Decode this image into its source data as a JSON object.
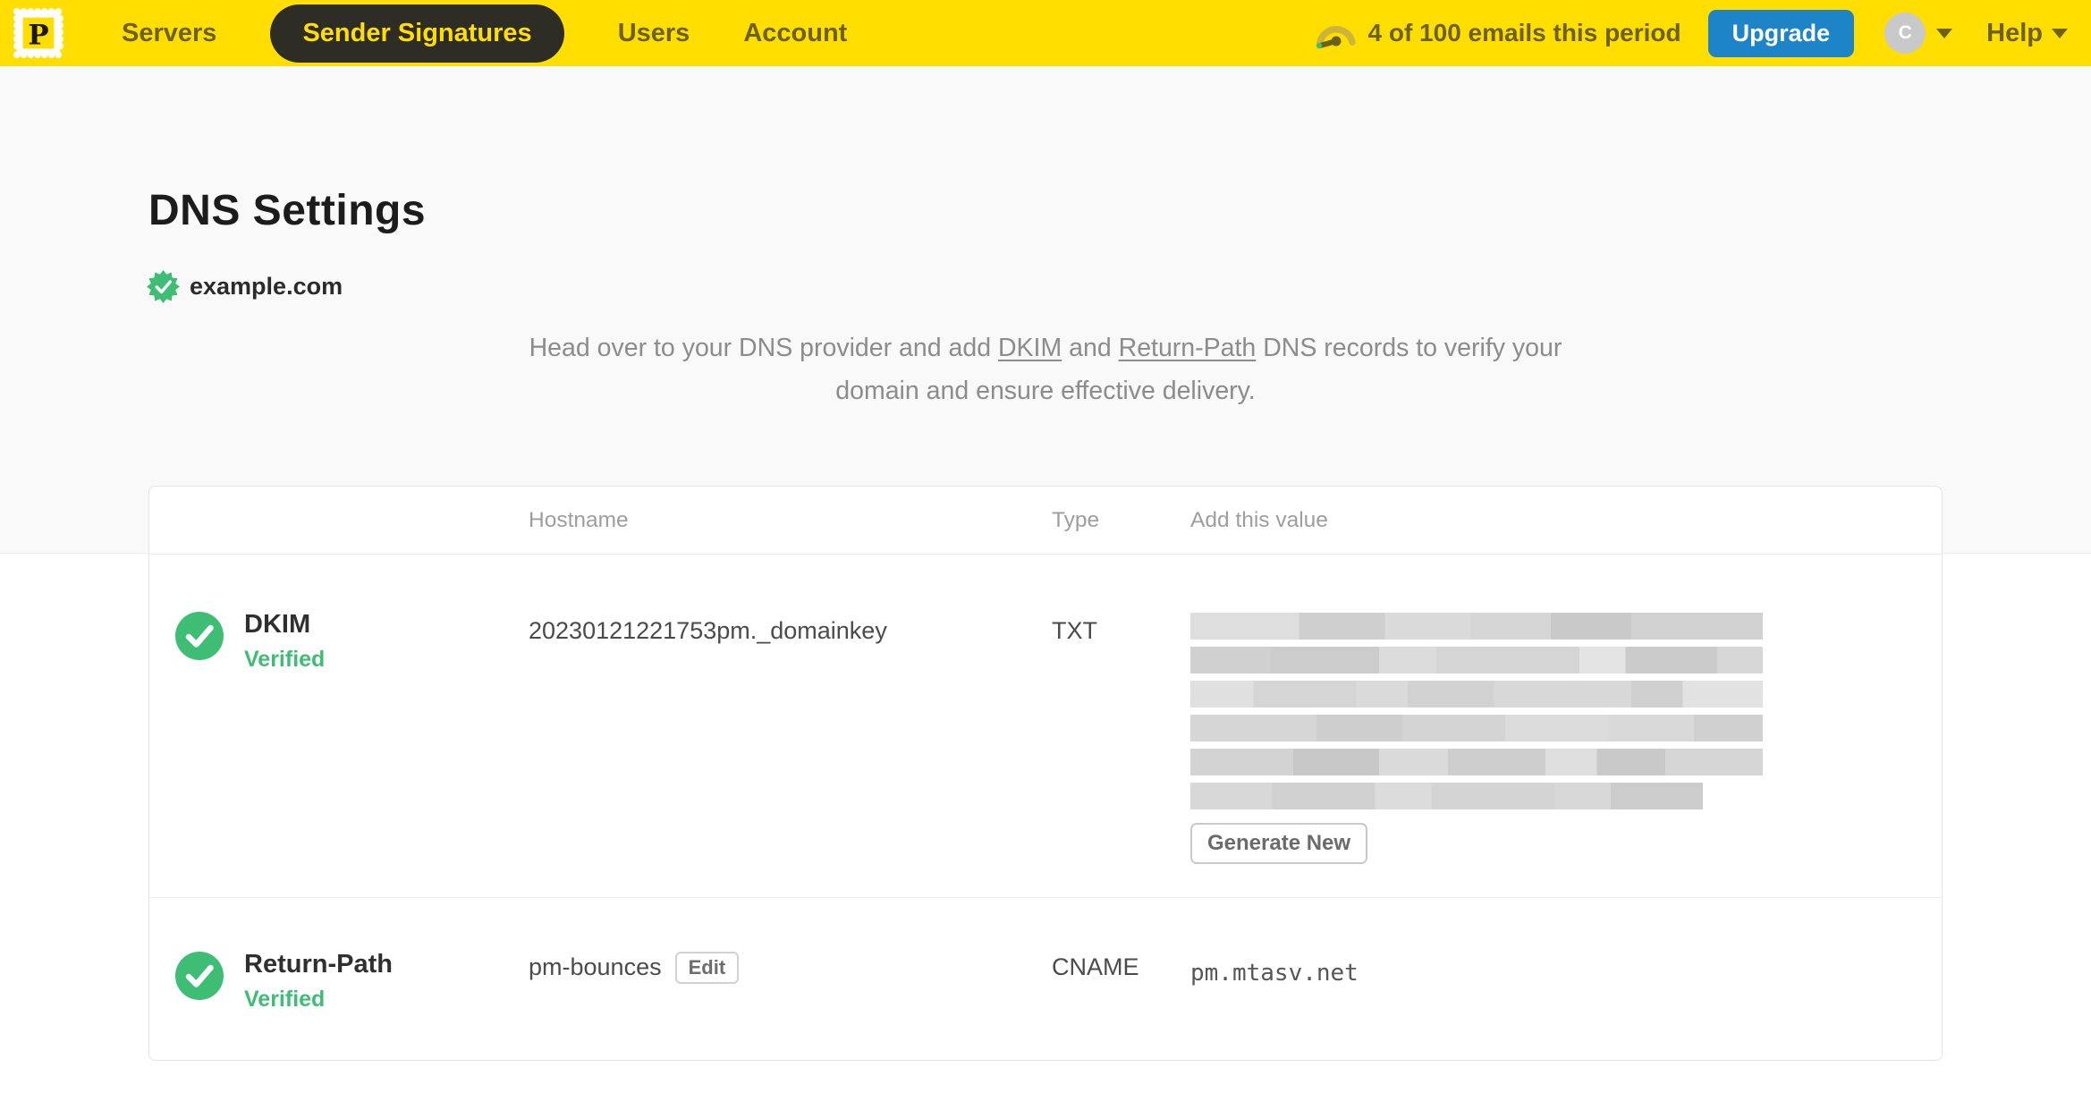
{
  "nav": {
    "logo_letter": "P",
    "items": [
      {
        "label": "Servers",
        "active": false
      },
      {
        "label": "Sender Signatures",
        "active": true
      },
      {
        "label": "Users",
        "active": false
      },
      {
        "label": "Account",
        "active": false
      }
    ],
    "usage_text": "4 of 100 emails this period",
    "upgrade_label": "Upgrade",
    "avatar_initial": "C",
    "help_label": "Help"
  },
  "page": {
    "title": "DNS Settings",
    "domain": "example.com",
    "domain_verified": true,
    "description": {
      "prefix": "Head over to your DNS provider and add ",
      "dkim_link": "DKIM",
      "conjunction": " and ",
      "return_path_link": "Return-Path",
      "suffix": " DNS records to verify your domain and ensure effective delivery."
    }
  },
  "table": {
    "headers": {
      "hostname": "Hostname",
      "type": "Type",
      "value": "Add this value"
    },
    "records": [
      {
        "name": "DKIM",
        "status": "Verified",
        "hostname": "20230121221753pm._domainkey",
        "type": "TXT",
        "value_redacted": true,
        "action_label": "Generate New"
      },
      {
        "name": "Return-Path",
        "status": "Verified",
        "hostname": "pm-bounces",
        "edit_label": "Edit",
        "type": "CNAME",
        "value": "pm.mtasv.net"
      }
    ]
  },
  "colors": {
    "brand_yellow": "#FFDE00",
    "nav_pill": "#2D2D26",
    "nav_text": "#6C6118",
    "upgrade_blue": "#1D84C8",
    "verified_green": "#3EBE75",
    "avatar_gray": "#C9C9C9"
  }
}
